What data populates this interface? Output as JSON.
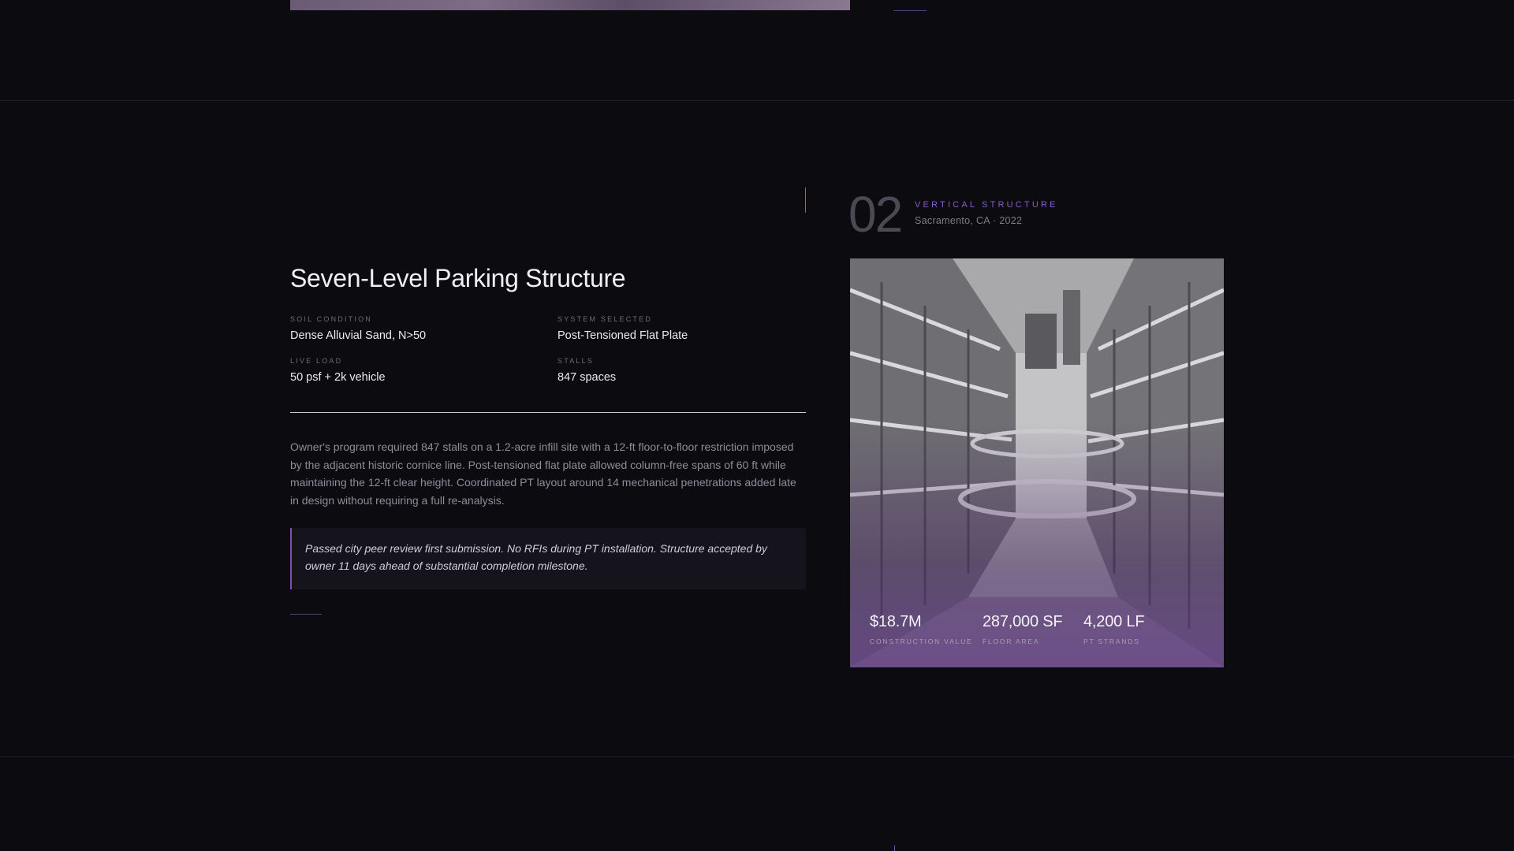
{
  "project": {
    "index": "02",
    "category": "Vertical Structure",
    "location": "Sacramento, CA · 2022",
    "title": "Seven-Level Parking Structure",
    "specs": [
      {
        "label": "Soil Condition",
        "value": "Dense Alluvial Sand, N>50"
      },
      {
        "label": "System Selected",
        "value": "Post-Tensioned Flat Plate"
      },
      {
        "label": "Live Load",
        "value": "50 psf + 2k vehicle"
      },
      {
        "label": "Stalls",
        "value": "847 spaces"
      }
    ],
    "description": "Owner's program required 847 stalls on a 1.2-acre infill site with a 12-ft floor-to-floor restriction imposed by the adjacent historic cornice line. Post-tensioned flat plate allowed column-free spans of 60 ft while maintaining the 12-ft clear height. Coordinated PT layout around 14 mechanical penetrations added late in design without requiring a full re-analysis.",
    "outcome": "Passed city peer review first submission. No RFIs during PT installation. Structure accepted by owner 11 days ahead of substantial completion milestone.",
    "stats": [
      {
        "value": "$18.7M",
        "label": "Construction Value"
      },
      {
        "value": "287,000 SF",
        "label": "Floor Area"
      },
      {
        "value": "4,200 LF",
        "label": "PT Strands"
      }
    ]
  },
  "colors": {
    "background": "#0b0b10",
    "accent": "#8b5cc9",
    "text": "#f1eff4",
    "muted": "#8e8d98"
  }
}
